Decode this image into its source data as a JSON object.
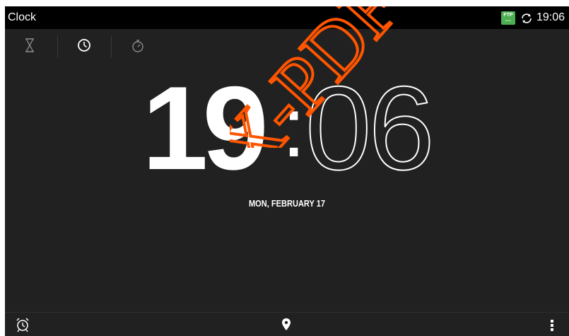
{
  "status_bar": {
    "app_title": "Clock",
    "ftp_badge": "FTP",
    "ftp_sub": "server",
    "time": "19:06"
  },
  "tabs": [
    {
      "name": "timer",
      "icon": "hourglass-icon",
      "selected": false
    },
    {
      "name": "clock",
      "icon": "clock-icon",
      "selected": true
    },
    {
      "name": "stopwatch",
      "icon": "stopwatch-icon",
      "selected": false
    }
  ],
  "clock": {
    "hour": "19",
    "separator": ":",
    "minutes": "06",
    "date": "MON, FEBRUARY 17"
  },
  "watermark": {
    "text": "X-PDF",
    "color": "#ff5500"
  },
  "bottom_bar": {
    "alarm_icon": "alarm-clock-icon",
    "location_icon": "location-pin-icon",
    "menu_icon": "overflow-menu-icon"
  },
  "colors": {
    "background": "#212121",
    "status_bar": "#000000",
    "ftp_badge": "#4caf50",
    "text": "#ffffff",
    "inactive_icon": "#8a8a8a"
  }
}
